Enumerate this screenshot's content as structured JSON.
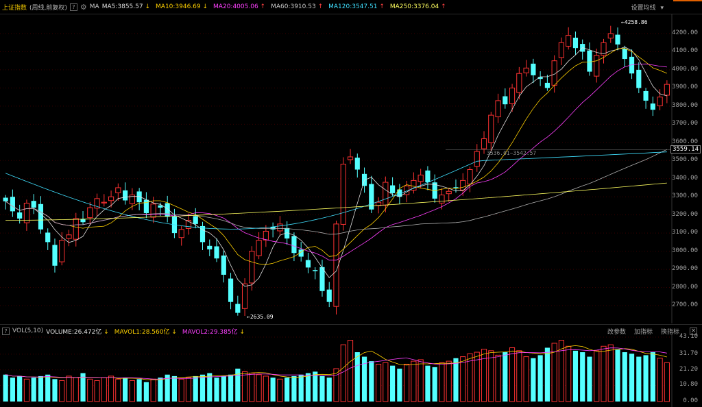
{
  "header": {
    "title": "上证指数",
    "subtitle": "(周线,前复权)",
    "help": "?",
    "ma_label": "MA",
    "ma_items": [
      {
        "text": "MA5:3855.57",
        "arrow": "↓",
        "color": "#e0e0e0"
      },
      {
        "text": "MA10:3946.69",
        "arrow": "↓",
        "color": "#ffd000"
      },
      {
        "text": "MA20:4005.06",
        "arrow": "↑",
        "color": "#ff40ff"
      },
      {
        "text": "MA60:3910.53",
        "arrow": "↑",
        "color": "#c8c8c8"
      },
      {
        "text": "MA120:3547.51",
        "arrow": "↑",
        "color": "#40e0ff"
      },
      {
        "text": "MA250:3376.04",
        "arrow": "↑",
        "color": "#ffff60"
      }
    ],
    "settings_label": "设置均线"
  },
  "volume_header": {
    "label": "VOL(5,10)",
    "help": "?",
    "items": [
      {
        "text": "VOLUME:26.472亿",
        "arrow": "↓",
        "color": "#e0e0e0"
      },
      {
        "text": "MAVOL1:28.560亿",
        "arrow": "↓",
        "color": "#ffd000"
      },
      {
        "text": "MAVOL2:29.385亿",
        "arrow": "↓",
        "color": "#ff40ff"
      }
    ],
    "links": [
      "改参数",
      "加指标",
      "换指标"
    ],
    "close": "×"
  },
  "price_axis": [
    "4200.00",
    "4100.00",
    "4000.00",
    "3900.00",
    "3800.00",
    "3700.00",
    "3600.00",
    "3500.00",
    "3400.00",
    "3300.00",
    "3200.00",
    "3100.00",
    "3000.00",
    "2900.00",
    "2800.00",
    "2700.00"
  ],
  "volume_axis": [
    "43.10",
    "31.70",
    "21.20",
    "10.80",
    "0.00"
  ],
  "current_price": "3559.14",
  "annotations": {
    "high": "4258.86",
    "low": "2635.09",
    "middle": "3536.01~3542.57"
  },
  "chart_data": {
    "type": "candlestick",
    "instrument": "上证指数",
    "period": "周线",
    "price_range": [
      2635.09,
      4258.86
    ],
    "volume_unit": "亿",
    "volume_range": [
      0,
      43.1
    ],
    "last_price": 3559.14,
    "moving_averages": {
      "MA5": 3855.57,
      "MA10": 3946.69,
      "MA20": 4005.06,
      "MA60": 3910.53,
      "MA120": 3547.51,
      "MA250": 3376.04
    },
    "volume_averages": {
      "VOLUME": 26.472,
      "MAVOL1": 28.56,
      "MAVOL2": 29.385
    },
    "candles_approx": [
      3275,
      3220,
      3180,
      3265,
      3240,
      3120,
      3050,
      2920,
      3060,
      3090,
      3180,
      3160,
      3240,
      3290,
      3270,
      3300,
      3350,
      3280,
      3310,
      3270,
      3210,
      3260,
      3240,
      3190,
      3100,
      3120,
      3170,
      3150,
      3050,
      3010,
      2960,
      2870,
      2720,
      2660,
      2820,
      3000,
      3060,
      3110,
      3120,
      3150,
      3070,
      2990,
      2970,
      2910,
      2890,
      2780,
      2720,
      3150,
      3480,
      3520,
      3450,
      3360,
      3230,
      3270,
      3380,
      3320,
      3300,
      3360,
      3390,
      3420,
      3380,
      3290,
      3310,
      3330,
      3350,
      3390,
      3450,
      3550,
      3620,
      3750,
      3830,
      3810,
      3900,
      3980,
      4010,
      3970,
      3950,
      3900,
      4050,
      4150,
      4190,
      4120,
      4100,
      3990,
      4080,
      4150,
      4200,
      4140,
      4060,
      3980,
      3900,
      3830,
      3780,
      3850,
      3920
    ],
    "volumes_approx": [
      18,
      16,
      17,
      15,
      16,
      17,
      18,
      15,
      14,
      17,
      16,
      19,
      15,
      14,
      16,
      17,
      15,
      16,
      14,
      15,
      13,
      15,
      16,
      18,
      17,
      15,
      16,
      17,
      18,
      19,
      16,
      17,
      18,
      22,
      20,
      19,
      18,
      17,
      16,
      15,
      16,
      17,
      18,
      19,
      20,
      17,
      16,
      22,
      38,
      41,
      33,
      30,
      27,
      25,
      26,
      24,
      22,
      25,
      27,
      28,
      24,
      23,
      26,
      27,
      29,
      30,
      32,
      33,
      35,
      34,
      31,
      33,
      36,
      34,
      30,
      29,
      31,
      36,
      39,
      41,
      37,
      34,
      33,
      30,
      34,
      37,
      38,
      35,
      33,
      32,
      30,
      31,
      33,
      29,
      26
    ]
  }
}
